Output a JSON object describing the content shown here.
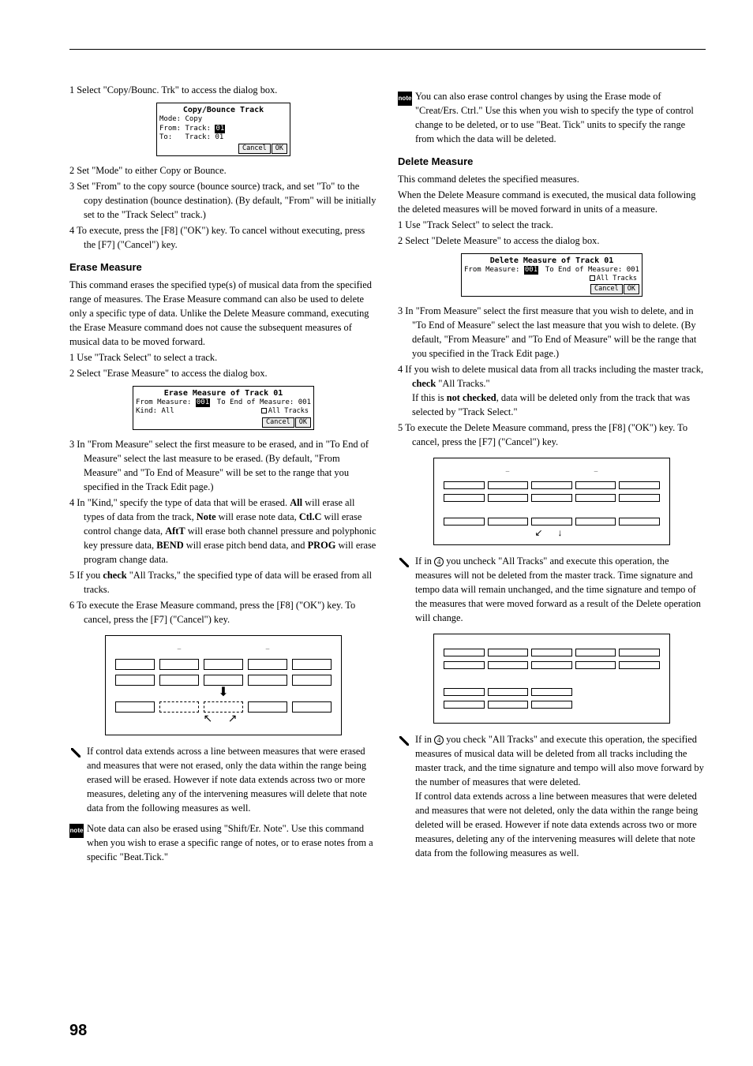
{
  "page_number": "98",
  "section_a": {
    "step1": "1 Select \"Copy/Bounc. Trk\" to access the dialog box.",
    "dialog1": {
      "title": "Copy/Bounce Track",
      "line1": "Mode: Copy",
      "line2_a": "From: Track:",
      "line2_b": "01",
      "line3": "To:   Track: 01",
      "cancel": "Cancel",
      "ok": "OK"
    },
    "step2": "2 Set \"Mode\" to either Copy or Bounce.",
    "step3": "3 Set \"From\" to the copy source (bounce source) track, and set \"To\" to the copy destination (bounce destination). (By default, \"From\" will be initially set to the \"Track Select\" track.)",
    "step4": "4 To execute, press the [F8] (\"OK\") key. To cancel without executing, press the [F7] (\"Cancel\") key."
  },
  "erase_measure": {
    "heading": "Erase Measure",
    "intro": "This command erases the specified type(s) of musical data from the specified range of measures. The Erase Measure command can also be used to delete only a specific type of data. Unlike the Delete Measure command, executing the Erase Measure command does not cause the subsequent measures of musical data to be moved forward.",
    "step1": "1 Use \"Track Select\" to select a track.",
    "step2": "2 Select \"Erase Measure\" to access the dialog box.",
    "dialog": {
      "title": "Erase Measure of Track 01",
      "from_a": "From Measure:",
      "from_b": "001",
      "to": "To End of Measure: 001",
      "kind": "Kind: All",
      "alltracks": "All Tracks",
      "cancel": "Cancel",
      "ok": "OK"
    },
    "step3": "3 In \"From Measure\" select the first measure to be erased, and in \"To End of Measure\" select the last measure to be erased. (By default, \"From Measure\" and \"To End of Measure\" will be set to the range that you specified in the Track Edit page.)",
    "step4_a": "4 In \"Kind,\" specify the type of data that will be erased. ",
    "step4_all": "All",
    "step4_b": " will erase all types of data from the track, ",
    "step4_note": "Note",
    "step4_c": " will erase note data, ",
    "step4_ctlc": "Ctl.C",
    "step4_d": " will erase control change data, ",
    "step4_aftt": "AftT",
    "step4_e": " will erase both channel pressure and polyphonic key pressure data, ",
    "step4_bend": "BEND",
    "step4_f": " will erase pitch bend data, and ",
    "step4_prog": "PROG",
    "step4_g": " will erase program change data.",
    "step5_a": "5 If you ",
    "step5_check": "check",
    "step5_b": " \"All Tracks,\" the specified type of data will be erased from all tracks.",
    "step6": "6 To execute the Erase Measure command, press the [F8] (\"OK\") key. To cancel, press the [F7] (\"Cancel\") key.",
    "warn": "If control data extends across a line between measures that were erased and measures that were not erased, only the data within the range being erased will be erased. However if note data extends across two or more measures, deleting any of the intervening measures will delete that note data from the following measures as well.",
    "note": "Note data can also be erased using \"Shift/Er. Note\". Use this command when you wish to erase a specific range of notes, or to erase notes from a specific \"Beat.Tick.\""
  },
  "right_top_note": "You can also erase control changes by using the Erase mode of \"Creat/Ers. Ctrl.\" Use this when you wish to specify the type of control change to be deleted, or to use \"Beat. Tick\" units to specify the range from which the data will be deleted.",
  "delete_measure": {
    "heading": "Delete Measure",
    "intro1": "This command deletes the specified measures.",
    "intro2": "When the Delete Measure command is executed, the musical data following the deleted measures will be moved forward in units of a measure.",
    "step1": "1 Use \"Track Select\" to select the track.",
    "step2": "2 Select \"Delete Measure\" to access the dialog box.",
    "dialog": {
      "title": "Delete Measure of Track 01",
      "from_a": "From Measure:",
      "from_b": "001",
      "to": "To End of Measure: 001",
      "alltracks": "All Tracks",
      "cancel": "Cancel",
      "ok": "OK"
    },
    "step3": "3 In \"From Measure\" select the first measure that you wish to delete, and in \"To End of Measure\" select the last measure that you wish to delete. (By default, \"From Measure\" and \"To End of Measure\" will be the range that you specified in the Track Edit page.)",
    "step4_a": "4 If you wish to delete musical data from all tracks including the master track, ",
    "step4_check": "check",
    "step4_b": " \"All Tracks.\"",
    "step4_c": "If this is ",
    "step4_ncheck": "not checked",
    "step4_d": ", data will be deleted only from the track that was selected by \"Track Select.\"",
    "step5": "5 To execute the Delete Measure command, press the [F8] (\"OK\") key. To cancel, press the [F7] (\"Cancel\") key.",
    "warn1": "If in 4 you uncheck \"All Tracks\" and execute this operation, the measures will not be deleted from the master track. Time signature and tempo data will remain unchanged, and the time signature and tempo of the measures that were moved forward as a result of the Delete operation will change.",
    "warn2": "If in 4 you check \"All Tracks\" and execute this operation, the specified measures of musical data will be deleted from all tracks including the master track, and the time signature and tempo will also move forward by the number of measures that were deleted.",
    "warn2b": "If control data extends across a line between measures that were deleted and measures that were not deleted, only the data within the range being deleted will be erased. However if note data extends across two or more measures, deleting any of the intervening measures will delete that note data from the following measures as well."
  },
  "icon_note_label": "note"
}
